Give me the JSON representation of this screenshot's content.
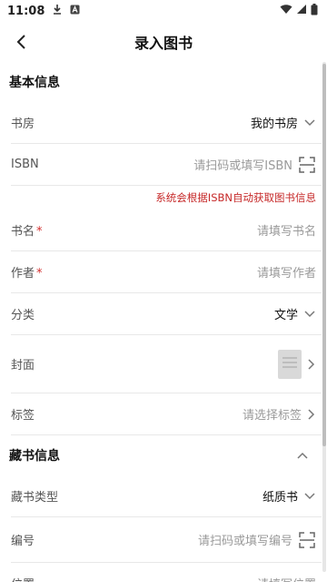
{
  "status": {
    "time": "11:08"
  },
  "header": {
    "title": "录入图书"
  },
  "sections": {
    "basic": "基本信息",
    "collection": "藏书信息"
  },
  "fields": {
    "study": {
      "label": "书房",
      "value": "我的书房"
    },
    "isbn": {
      "label": "ISBN",
      "placeholder": "请扫码或填写ISBN",
      "hint": "系统会根据ISBN自动获取图书信息"
    },
    "title": {
      "label": "书名",
      "required": "*",
      "placeholder": "请填写书名"
    },
    "author": {
      "label": "作者",
      "required": "*",
      "placeholder": "请填写作者"
    },
    "category": {
      "label": "分类",
      "value": "文学"
    },
    "cover": {
      "label": "封面"
    },
    "tags": {
      "label": "标签",
      "placeholder": "请选择标签"
    },
    "collection_type": {
      "label": "藏书类型",
      "value": "纸质书"
    },
    "number": {
      "label": "编号",
      "placeholder": "请扫码或填写编号"
    },
    "location": {
      "label": "位置",
      "placeholder": "请填写位置"
    }
  }
}
